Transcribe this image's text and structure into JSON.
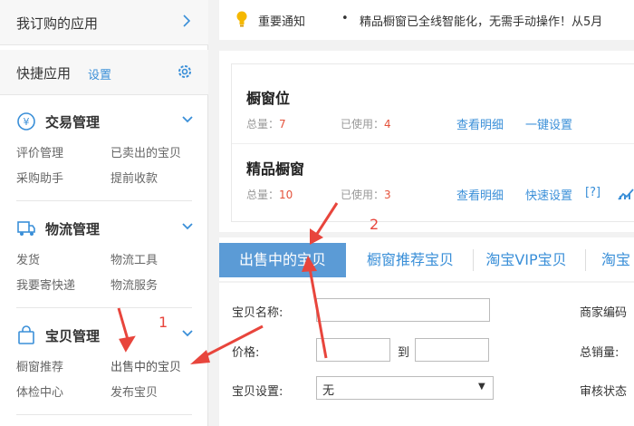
{
  "sidebar": {
    "my_apps": "我订购的应用",
    "quick_apps": "快捷应用",
    "settings_link": "设置",
    "groups": [
      {
        "title": "交易管理",
        "icon": "yen-circle-icon",
        "items": [
          "评价管理",
          "已卖出的宝贝",
          "采购助手",
          "提前收款"
        ]
      },
      {
        "title": "物流管理",
        "icon": "truck-icon",
        "items": [
          "发货",
          "物流工具",
          "我要寄快递",
          "物流服务"
        ]
      },
      {
        "title": "宝贝管理",
        "icon": "bag-icon",
        "items": [
          "橱窗推荐",
          "出售中的宝贝",
          "体检中心",
          "发布宝贝"
        ]
      }
    ]
  },
  "notice": {
    "title": "重要通知",
    "bullet": "•",
    "text": "精品橱窗已全线智能化，无需手动操作！从5月"
  },
  "windows": {
    "rows": [
      {
        "title": "橱窗位",
        "total_label": "总量：",
        "total": "7",
        "used_label": "已使用：",
        "used": "4",
        "detail": "查看明细",
        "action": "一键设置"
      },
      {
        "title": "精品橱窗",
        "total_label": "总量：",
        "total": "10",
        "used_label": "已使用：",
        "used": "3",
        "detail": "查看明细",
        "action": "快速设置",
        "help": "[?]"
      }
    ]
  },
  "tabs": [
    "出售中的宝贝",
    "橱窗推荐宝贝",
    "淘宝VIP宝贝",
    "淘宝"
  ],
  "form": {
    "name_label": "宝贝名称:",
    "price_label": "价格:",
    "to_label": "到",
    "settings_label": "宝贝设置:",
    "settings_value": "无",
    "merchant_code_label": "商家编码",
    "total_sales_label": "总销量:",
    "audit_status_label": "审核状态"
  },
  "annotations": {
    "step1": "1",
    "step2": "2"
  },
  "colors": {
    "accent": "#3a8fd8",
    "active_tab": "#5b9bd6",
    "arrow": "#e8453c",
    "number": "#e4523b"
  }
}
